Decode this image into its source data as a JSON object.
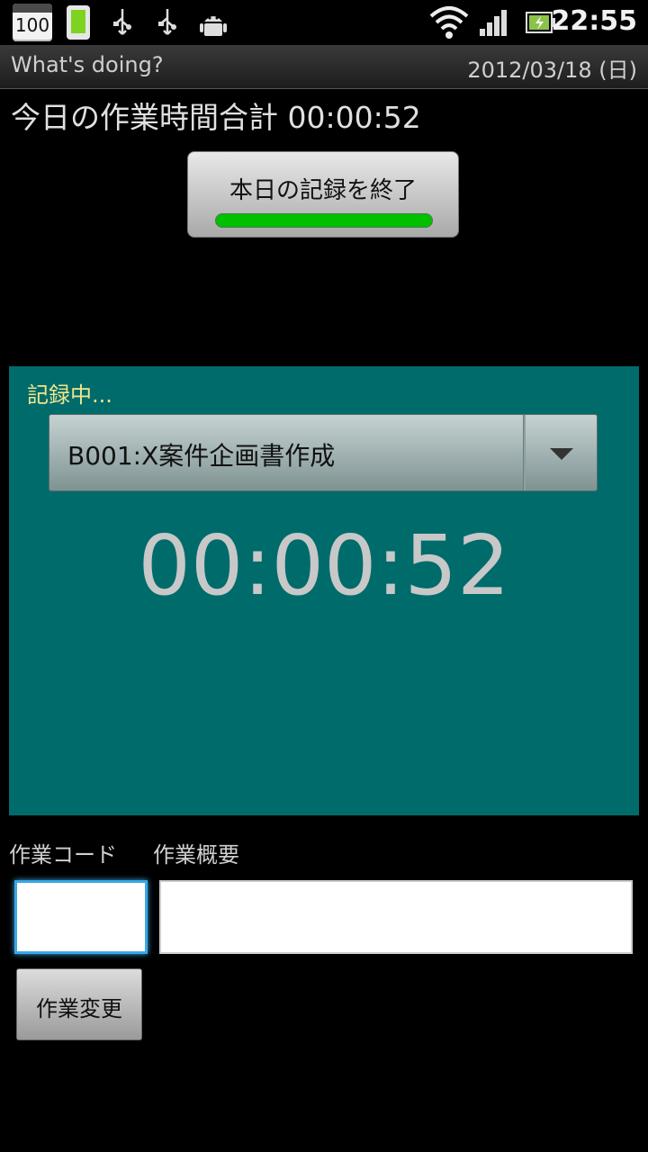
{
  "status_bar": {
    "calendar_day": "100",
    "time": "22:55",
    "icons": [
      "calendar-icon",
      "phone-icon",
      "usb-icon",
      "usb-icon",
      "android-icon",
      "wifi-icon",
      "signal-icon",
      "battery-icon"
    ]
  },
  "title_bar": {
    "app_title": "What's doing?",
    "date": "2012/03/18 (日)"
  },
  "summary": {
    "total_label": "今日の作業時間合計 00:00:52"
  },
  "end_button": {
    "label": "本日の記録を終了",
    "indicator_color": "#00c000"
  },
  "recording": {
    "status_label": "記録中...",
    "selected_task": "B001:X案件企画書作成",
    "timer": "00:00:52",
    "panel_color": "#006b6b"
  },
  "form": {
    "code_label": "作業コード",
    "summary_label": "作業概要",
    "code_value": "",
    "summary_value": "",
    "change_button_label": "作業変更"
  }
}
